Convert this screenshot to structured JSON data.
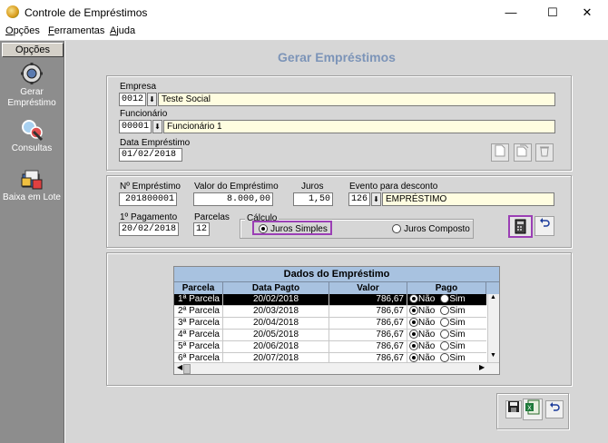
{
  "window": {
    "title": "Controle de Empréstimos",
    "minimize_glyph": "—",
    "maximize_glyph": "☐",
    "close_glyph": "✕"
  },
  "menu": {
    "items": [
      {
        "label": "Opções"
      },
      {
        "label": "Ferramentas"
      },
      {
        "label": "Ajuda"
      }
    ]
  },
  "sidebar": {
    "header": "Opções",
    "items": [
      {
        "label": "Gerar Empréstimo",
        "icon": "gear-money-icon"
      },
      {
        "label": "Consultas",
        "icon": "magnifier-icon"
      },
      {
        "label": "Baixa em Lote",
        "icon": "folder-icon"
      }
    ]
  },
  "form": {
    "title": "Gerar Empréstimos",
    "empresa": {
      "label": "Empresa",
      "code": "0012",
      "name": "Teste Social"
    },
    "funcionario": {
      "label": "Funcionário",
      "code": "00001",
      "name": "Funcionário 1"
    },
    "data_emprestimo": {
      "label": "Data Empréstimo",
      "value": "01/02/2018"
    },
    "numero": {
      "label": "Nº Empréstimo",
      "value": "201800001"
    },
    "valor": {
      "label": "Valor do Empréstimo",
      "value": "8.000,00"
    },
    "juros": {
      "label": "Juros",
      "value": "1,50"
    },
    "evento": {
      "label": "Evento para desconto",
      "code": "126",
      "name": "EMPRÉSTIMO"
    },
    "primeiro_pagamento": {
      "label": "1º Pagamento",
      "value": "20/02/2018"
    },
    "parcelas": {
      "label": "Parcelas",
      "value": "12"
    },
    "calculo": {
      "label": "Cálculo",
      "simples": "Juros Simples",
      "composto": "Juros Composto",
      "selected": "simples"
    }
  },
  "grid": {
    "title": "Dados do Empréstimo",
    "columns": [
      "Parcela",
      "Data Pagto",
      "Valor",
      "Pago"
    ],
    "radio_no": "Não",
    "radio_yes": "Sim",
    "rows": [
      {
        "parcela": "1ª Parcela",
        "data": "20/02/2018",
        "valor": "786,67",
        "pago": "nao",
        "selected": true
      },
      {
        "parcela": "2ª Parcela",
        "data": "20/03/2018",
        "valor": "786,67",
        "pago": "nao"
      },
      {
        "parcela": "3ª Parcela",
        "data": "20/04/2018",
        "valor": "786,67",
        "pago": "nao"
      },
      {
        "parcela": "4ª Parcela",
        "data": "20/05/2018",
        "valor": "786,67",
        "pago": "nao"
      },
      {
        "parcela": "5ª Parcela",
        "data": "20/06/2018",
        "valor": "786,67",
        "pago": "nao"
      },
      {
        "parcela": "6ª Parcela",
        "data": "20/07/2018",
        "valor": "786,67",
        "pago": "nao"
      }
    ]
  },
  "colors": {
    "sidebar_bg": "#8d8d8d",
    "form_bg": "#d6d6d6",
    "title_color": "#7c94b8",
    "highlight_border": "#9b3fb5",
    "grid_header": "#a8c2e0",
    "field_yellow": "#fffde0"
  }
}
